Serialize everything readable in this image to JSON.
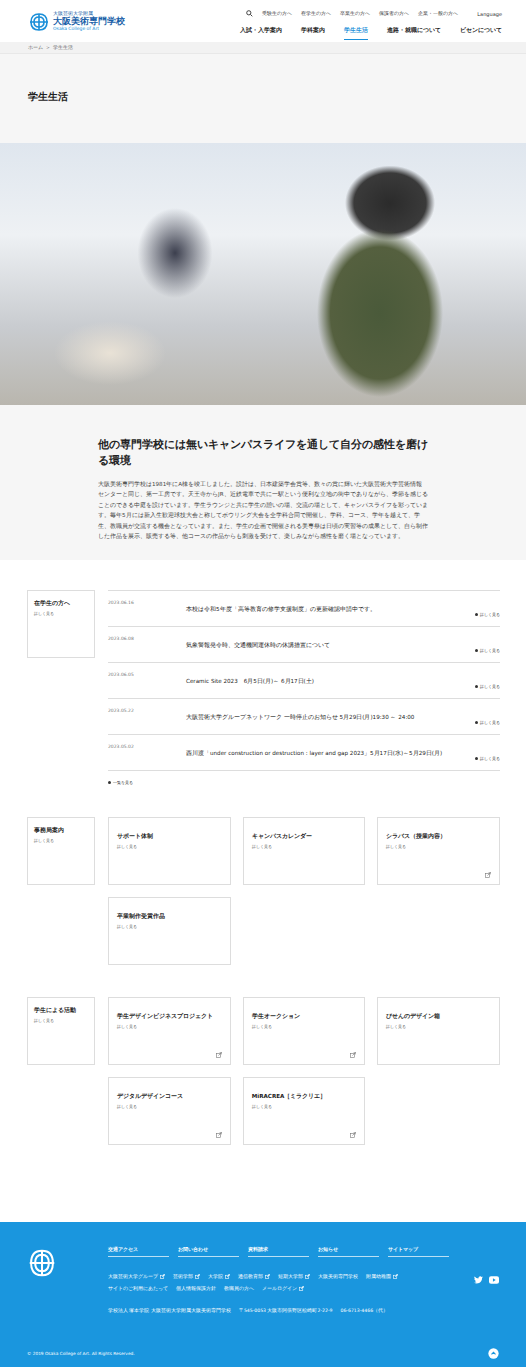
{
  "header": {
    "logo": {
      "sub": "大阪芸術大学附属",
      "main": "大阪美術専門学校",
      "en": "Osaka College of Art"
    },
    "top_links": [
      "受験生の方へ",
      "在学生の方へ",
      "卒業生の方へ",
      "保護者の方へ",
      "企業・一般の方へ"
    ],
    "language": "Language",
    "nav": [
      {
        "label": "入試・入学案内",
        "selected": false
      },
      {
        "label": "学科案内",
        "selected": false
      },
      {
        "label": "学生生活",
        "selected": true
      },
      {
        "label": "進路・就職について",
        "selected": false
      },
      {
        "label": "ビセンについて",
        "selected": false
      }
    ]
  },
  "breadcrumb": {
    "items": [
      "ホーム",
      "学生生活"
    ],
    "separator": ">"
  },
  "page_title": "学生生活",
  "intro": {
    "heading": "他の専門学校には無いキャンパスライフを通して自分の感性を磨ける環境",
    "body": "大阪美術専門学校は1981年にA棟を竣工しました。設計は、日本建築学会賞等、数々の賞に輝いた大阪芸術大学芸術情報センターと同じ、第一工房です。天王寺からJR、近鉄電車で共に一駅という便利な立地の街中でありながら、季節を感じることのできる中庭を設けています。学生ラウンジと共に学生の憩いの場、交流の場として、キャンパスライフを彩っています。毎年5月には新入生歓迎球技大会と称してボウリング大会を全学科合同で開催し、学科、コース、学年を越えて、学生、教職員が交流する機会となっています。また、学生の企画で開催される美専祭は日頃の実習等の成果として、自ら制作した作品を展示、販売する等、他コースの作品からも刺激を受けて、楽しみながら感性を磨く場となっています。"
  },
  "news": {
    "label": "在学生の方へ",
    "more": "詳しく見る",
    "items": [
      {
        "date": "2023.06.16",
        "title": "本校は令和5年度「高等教育の修学支援制度」の更新確認申請中です。",
        "more": "詳しく見る"
      },
      {
        "date": "2023.06.08",
        "title": "気象警報発令時、交通機関運休時の休講措置について",
        "more": "詳しく見る"
      },
      {
        "date": "2023.06.05",
        "title": "Ceramic Site 2023　6月5日(月)～ 6月17日(土)",
        "more": "詳しく見る"
      },
      {
        "date": "2023.05.22",
        "title": "大阪芸術大学グループネットワーク 一時停止のお知らせ 5月29日(月)19:30 ～ 24:00",
        "more": "詳しく見る"
      },
      {
        "date": "2023.05.02",
        "title": "西川渡「under construction or destruction : layer and gap 2023」5月17日(水)～5月29日(月)",
        "more": "詳しく見る"
      }
    ],
    "list_link": "一覧を見る"
  },
  "sections": [
    {
      "label": "事務局案内",
      "more": "詳しく見る",
      "cards": [
        {
          "title": "サポート体制",
          "more": "詳しく見る",
          "external": false
        },
        {
          "title": "キャンパスカレンダー",
          "more": "詳しく見る",
          "external": false
        },
        {
          "title": "シラバス（授業内容）",
          "more": "詳しく見る",
          "external": true
        },
        {
          "title": "卒業制作受賞作品",
          "more": "詳しく見る",
          "external": false
        }
      ]
    },
    {
      "label": "学生による活動",
      "more": "詳しく見る",
      "cards": [
        {
          "title": "学生デザインビジネスプロジェクト",
          "more": "詳しく見る",
          "external": true
        },
        {
          "title": "学生オークション",
          "more": "詳しく見る",
          "external": true
        },
        {
          "title": "びせんのデザイン箱",
          "more": "詳しく見る",
          "external": false
        },
        {
          "title": "デジタルデザインコース",
          "more": "詳しく見る",
          "external": true
        },
        {
          "title": "MiRACREA［ミラクリエ］",
          "more": "詳しく見る",
          "external": true
        }
      ]
    }
  ],
  "footer": {
    "headings": [
      "交通アクセス",
      "お問い合わせ",
      "資料請求",
      "お知らせ",
      "サイトマップ"
    ],
    "links_row1": [
      {
        "label": "大阪芸術大学グループ",
        "external": true
      },
      {
        "label": "芸術学部",
        "external": true
      },
      {
        "label": "大学院",
        "external": true
      },
      {
        "label": "通信教育部",
        "external": true
      },
      {
        "label": "短期大学部",
        "external": true
      },
      {
        "label": "大阪美術専門学校",
        "external": false
      },
      {
        "label": "附属幼稚園",
        "external": true
      }
    ],
    "links_row2": [
      {
        "label": "サイトのご利用にあたって",
        "external": false
      },
      {
        "label": "個人情報保護方針",
        "external": false
      },
      {
        "label": "教職員の方へ",
        "external": false
      },
      {
        "label": "メールログイン",
        "external": true
      }
    ],
    "address": [
      "学校法人 塚本学院 大阪芸術大学附属大阪美術専門学校",
      "〒545-0053 大阪市阿倍野区松崎町2-22-9",
      "06-6713-4466（代）"
    ],
    "copyright": "© 2019 Osaka College of Art. All Rights Reserved."
  }
}
